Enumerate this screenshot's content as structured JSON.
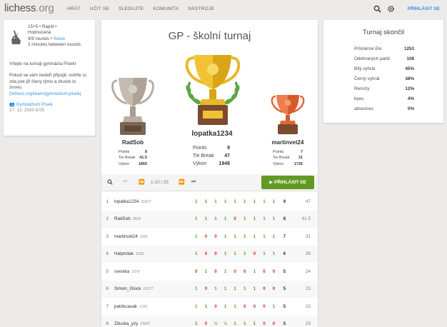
{
  "header": {
    "logo_main": "lichess",
    "logo_tld": ".org",
    "nav": [
      "HRÁT",
      "UČIT SE",
      "SLEDUJTE",
      "KOMUNITA",
      "NÁSTROJE"
    ],
    "login": "PŘIHLÁSIT SE"
  },
  "info": {
    "line1": "15+5 • Rapid •",
    "line2": "Hodnocená",
    "rounds": "9/9 rounds •",
    "system": "Swiss",
    "interval": "2 minutes between rounds",
    "welcome": "Vítejte na turnaji gymnázia Písek!",
    "note": "Pokud se vám nedaří připojit, ověřte si, zda jste již členy týmu a zkuste to znovu.",
    "link": "(lichess.org/team/gymnazium-pisek)",
    "team": "Gymnázium Písek",
    "date": "17. 12. 2020 8:05"
  },
  "tournament": {
    "title": "GP - školní turnaj"
  },
  "podium": {
    "first": {
      "name": "lopatka1234",
      "points": "9",
      "tiebreak": "47",
      "perf": "1948"
    },
    "second": {
      "name": "RadSob",
      "points": "8",
      "tiebreak": "41.5",
      "perf": "1869"
    },
    "third": {
      "name": "martinvet24",
      "points": "7",
      "tiebreak": "31",
      "perf": "1726"
    },
    "labels": {
      "points": "Points",
      "tiebreak": "Tie Break",
      "perf": "Výkon"
    }
  },
  "controls": {
    "page": "1-10 / 25",
    "join": "PŘIHLÁSIT SE"
  },
  "standings": [
    {
      "rank": "1",
      "name": "lopatka1234",
      "rating": "21517",
      "results": [
        "1",
        "1",
        "1",
        "1",
        "1",
        "1",
        "1",
        "1",
        "1"
      ],
      "total": "9",
      "tb": "47"
    },
    {
      "rank": "2",
      "name": "RadSob",
      "rating": "2024",
      "results": [
        "1",
        "1",
        "1",
        "1",
        "0",
        "1",
        "1",
        "1",
        "1"
      ],
      "total": "8",
      "tb": "41.5"
    },
    {
      "rank": "3",
      "name": "martinvet24",
      "rating": "1641",
      "results": [
        "1",
        "0",
        "0",
        "1",
        "1",
        "1",
        "1",
        "1",
        "1"
      ],
      "total": "7",
      "tb": "31"
    },
    {
      "rank": "4",
      "name": "Halprotak",
      "rating": "1253",
      "results": [
        "1",
        "0",
        "0",
        "1",
        "1",
        "1",
        "0",
        "1",
        "1"
      ],
      "total": "6",
      "tb": "26"
    },
    {
      "rank": "5",
      "name": "svestka",
      "rating": "1579",
      "results": [
        "0",
        "1",
        "0",
        "1",
        "0",
        "0",
        "1",
        "0",
        "0"
      ],
      "total": "5",
      "tb": "24"
    },
    {
      "rank": "6",
      "name": "Simon_Gluck",
      "rating": "15177",
      "results": [
        "1",
        "0",
        "1",
        "1",
        "1",
        "1",
        "1",
        "0",
        "0"
      ],
      "total": "5",
      "tb": "23"
    },
    {
      "rank": "7",
      "name": "patrikcasak",
      "rating": "1725",
      "results": [
        "1",
        "1",
        "0",
        "1",
        "1",
        "0",
        "0",
        "0",
        "1"
      ],
      "total": "5",
      "tb": "23"
    },
    {
      "rank": "8",
      "name": "Zituska_yzy",
      "rating": "15007",
      "results": [
        "1",
        "0",
        "½",
        "½",
        "1",
        "1",
        "1",
        "0",
        "0"
      ],
      "total": "5",
      "tb": "23"
    }
  ],
  "summary": {
    "title": "Turnaj skončil",
    "rows": [
      {
        "label": "Průměrné Elo",
        "value": "1253"
      },
      {
        "label": "Odehraných partií",
        "value": "108"
      },
      {
        "label": "Bílý vyhrál",
        "value": "45%"
      },
      {
        "label": "Černý vyhrál",
        "value": "38%"
      },
      {
        "label": "Remízy",
        "value": "12%"
      },
      {
        "label": "byes",
        "value": "4%"
      },
      {
        "label": "absences",
        "value": "0%"
      }
    ]
  },
  "colors": {
    "accent": "#3692e7",
    "win": "#629924",
    "loss": "#cc3333",
    "gold": "#e0b02a",
    "silver": "#b8aea2",
    "bronze": "#e0673a"
  }
}
